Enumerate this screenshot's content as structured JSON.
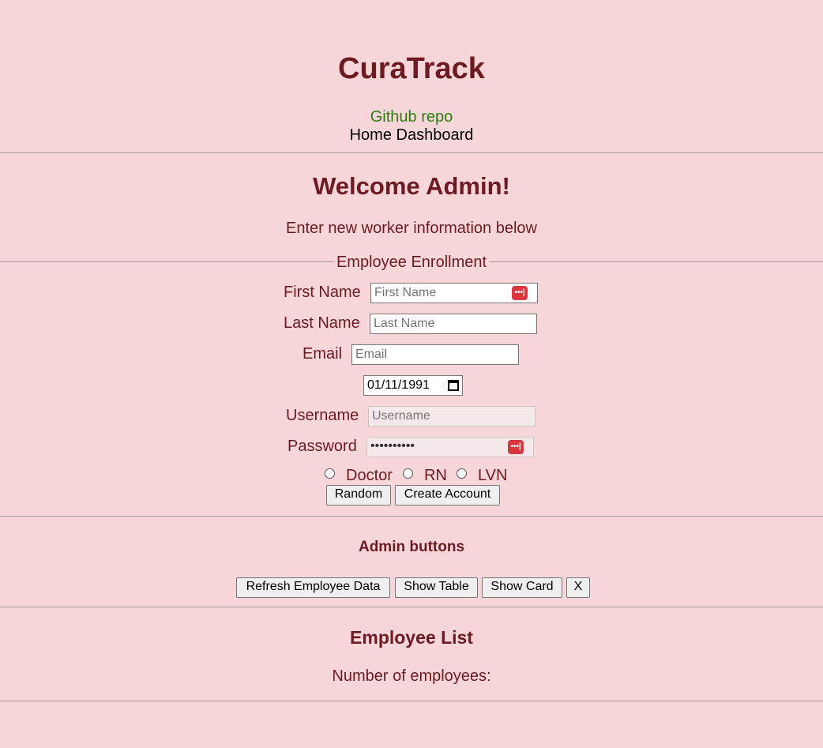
{
  "header": {
    "title": "CuraTrack",
    "github_link": "Github repo",
    "nav": {
      "home": "Home",
      "dashboard": "Dashboard"
    }
  },
  "welcome": {
    "title": "Welcome Admin!",
    "subtitle": "Enter new worker information below"
  },
  "enrollment": {
    "legend": "Employee Enrollment",
    "first_name": {
      "label": "First Name",
      "placeholder": "First Name",
      "value": ""
    },
    "last_name": {
      "label": "Last Name",
      "placeholder": "Last Name",
      "value": ""
    },
    "email": {
      "label": "Email",
      "placeholder": "Email",
      "value": ""
    },
    "birthdate": {
      "value": "01/11/1991"
    },
    "username": {
      "label": "Username",
      "placeholder": "Username",
      "value": ""
    },
    "password": {
      "label": "Password",
      "masked_value": "••••••••••"
    },
    "roles": [
      {
        "label": "Doctor",
        "selected": false
      },
      {
        "label": "RN",
        "selected": false
      },
      {
        "label": "LVN",
        "selected": false
      }
    ],
    "random_button": "Random",
    "create_button": "Create Account"
  },
  "admin": {
    "heading": "Admin buttons",
    "buttons": {
      "refresh": "Refresh Employee Data",
      "show_table": "Show Table",
      "show_card": "Show Card",
      "close": "X"
    }
  },
  "employee_list": {
    "heading": "Employee List",
    "count_label": "Number of employees:"
  },
  "icons": {
    "password_manager": "password-manager-icon",
    "calendar": "calendar-icon"
  },
  "colors": {
    "background": "#f7d6d9",
    "text": "#6e1a22",
    "link": "#2e7d0f",
    "password_manager": "#d9363e"
  }
}
